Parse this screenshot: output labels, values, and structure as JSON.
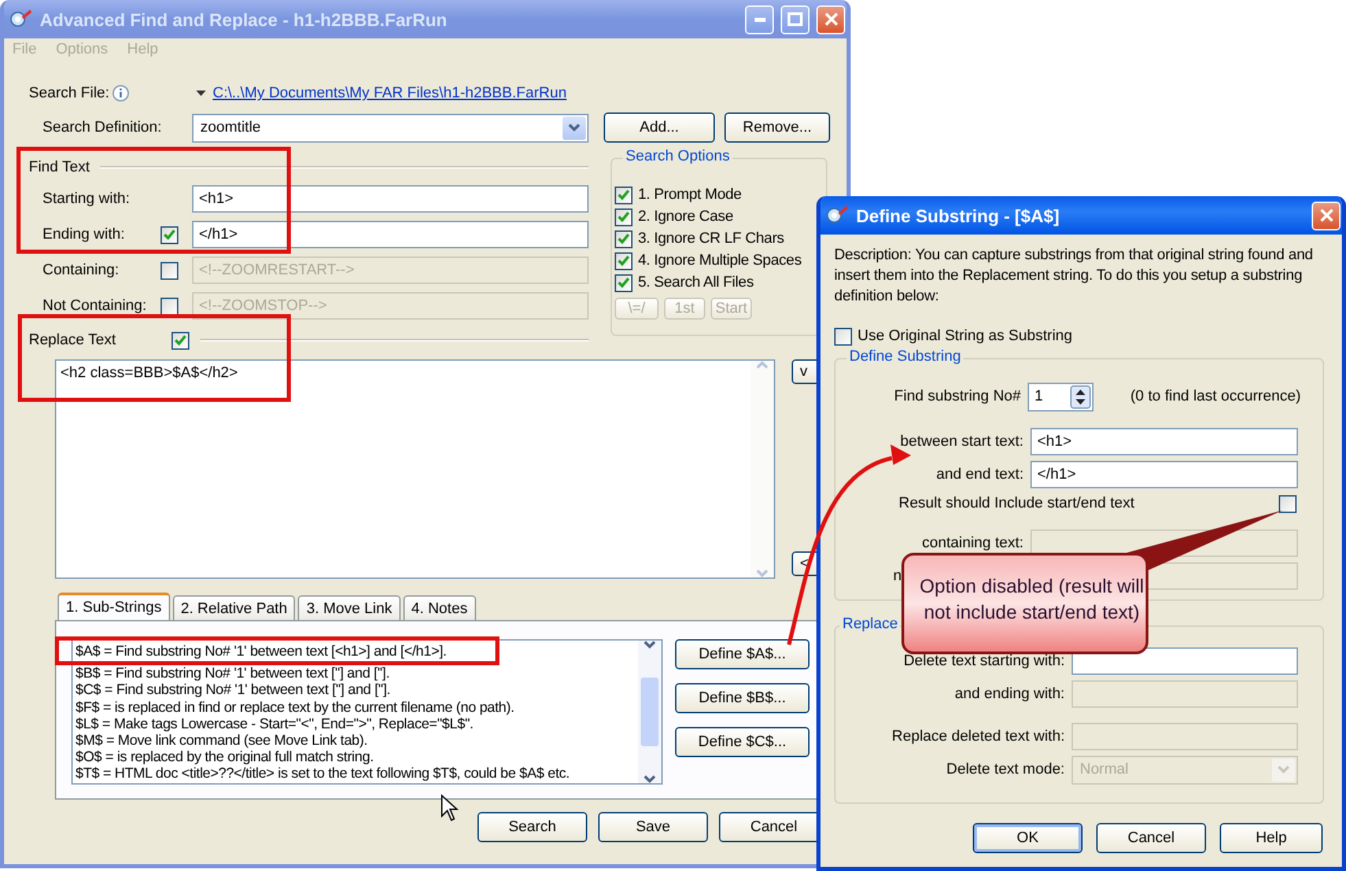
{
  "main_window": {
    "title": "Advanced Find and Replace - h1-h2BBB.FarRun",
    "menu": [
      {
        "label": "File",
        "disabled": true
      },
      {
        "label": "Options",
        "disabled": true
      },
      {
        "label": "Help",
        "disabled": true
      }
    ],
    "search_file": {
      "label": "Search File:",
      "path": "C:\\..\\My Documents\\My FAR Files\\h1-h2BBB.FarRun"
    },
    "search_definition": {
      "label": "Search Definition:",
      "value": "zoomtitle"
    },
    "definition_buttons": [
      "Add...",
      "Remove..."
    ],
    "find_text": {
      "heading": "Find Text",
      "rows": [
        {
          "kind": "plain",
          "label": "Starting with:",
          "value": "<h1>",
          "disabled": false
        },
        {
          "kind": "checkbox",
          "label": "Ending with:",
          "checked": true,
          "value": "</h1>",
          "disabled": false
        },
        {
          "kind": "checkbox",
          "label": "Containing:",
          "checked": false,
          "value": "<!--ZOOMRESTART-->",
          "disabled": true
        },
        {
          "kind": "checkbox",
          "label": "Not Containing:",
          "checked": false,
          "value": "<!--ZOOMSTOP-->",
          "disabled": true
        }
      ]
    },
    "replace_text": {
      "heading": "Replace Text",
      "checked": true,
      "value": "<h2 class=BBB>$A$</h2>"
    },
    "side_buttons": [
      "v",
      "<"
    ],
    "search_options": {
      "title": "Search Options",
      "options": [
        {
          "label": "1. Prompt Mode",
          "checked": true
        },
        {
          "label": "2. Ignore Case",
          "checked": true
        },
        {
          "label": "3. Ignore CR LF Chars",
          "checked": true
        },
        {
          "label": "4. Ignore Multiple Spaces",
          "checked": true
        },
        {
          "label": "5. Search All Files",
          "checked": true
        }
      ],
      "buttons": [
        {
          "label": "\\=/",
          "disabled": true
        },
        {
          "label": "1st",
          "disabled": true
        },
        {
          "label": "Start",
          "disabled": true
        }
      ]
    },
    "tabs": [
      {
        "label": "1. Sub-Strings",
        "selected": true
      },
      {
        "label": "2. Relative Path",
        "selected": false
      },
      {
        "label": "3. Move Link",
        "selected": false
      },
      {
        "label": "4. Notes",
        "selected": false
      }
    ],
    "substrings": [
      "$A$ = Find substring No# '1' between text [<h1>] and [</h1>].",
      "$B$ = Find substring No# '1' between text [''] and [''].",
      "$C$ = Find substring No# '1' between text [''] and [''].",
      "$F$ = is replaced in find or replace text by the current filename (no path).",
      "$L$ = Make tags Lowercase - Start=\"<\", End=\">\", Replace=\"$L$\".",
      "$M$ = Move link command (see Move Link tab).",
      "$O$ = is replaced by the original full match string.",
      "$T$ = HTML doc <title>??</title> is set to the text following $T$, could be $A$ etc."
    ],
    "define_buttons": [
      "Define $A$...",
      "Define $B$...",
      "Define $C$..."
    ],
    "bottom_buttons": [
      "Search",
      "Save",
      "Cancel"
    ]
  },
  "dialog": {
    "title": "Define Substring - [$A$]",
    "description": "Description: You can capture substrings from that original string found and insert them into the Replacement string. To do this you setup a substring definition below:",
    "use_original": {
      "label": "Use Original String as Substring",
      "checked": false
    },
    "define_group": {
      "title": "Define Substring",
      "find_label": "Find substring No#",
      "find_value": "1",
      "find_hint": "(0 to find last occurrence)",
      "fields": [
        {
          "label": "between start text:",
          "value": "<h1>",
          "disabled": false
        },
        {
          "label": "and end text:",
          "value": "</h1>",
          "disabled": false
        }
      ],
      "include": {
        "label": "Result should Include start/end text",
        "checked": false
      },
      "more_fields": [
        {
          "kind": "full",
          "label": "containing text:",
          "disabled": true
        },
        {
          "kind": "covered",
          "label": "n",
          "disabled": true
        }
      ]
    },
    "replace_group": {
      "title": "Replace",
      "fields": [
        {
          "label": "Delete text starting with:",
          "disabled": false
        },
        {
          "label": "and ending with:",
          "disabled": true
        },
        {
          "label": "Replace deleted text with:",
          "disabled": true
        }
      ],
      "mode": {
        "label": "Delete text mode:",
        "value": "Normal",
        "disabled": true
      }
    },
    "buttons": [
      {
        "label": "OK",
        "default": true
      },
      {
        "label": "Cancel",
        "default": false
      },
      {
        "label": "Help",
        "default": false
      }
    ]
  },
  "callout": {
    "text": "Option disabled (result will not include start/end text)"
  }
}
